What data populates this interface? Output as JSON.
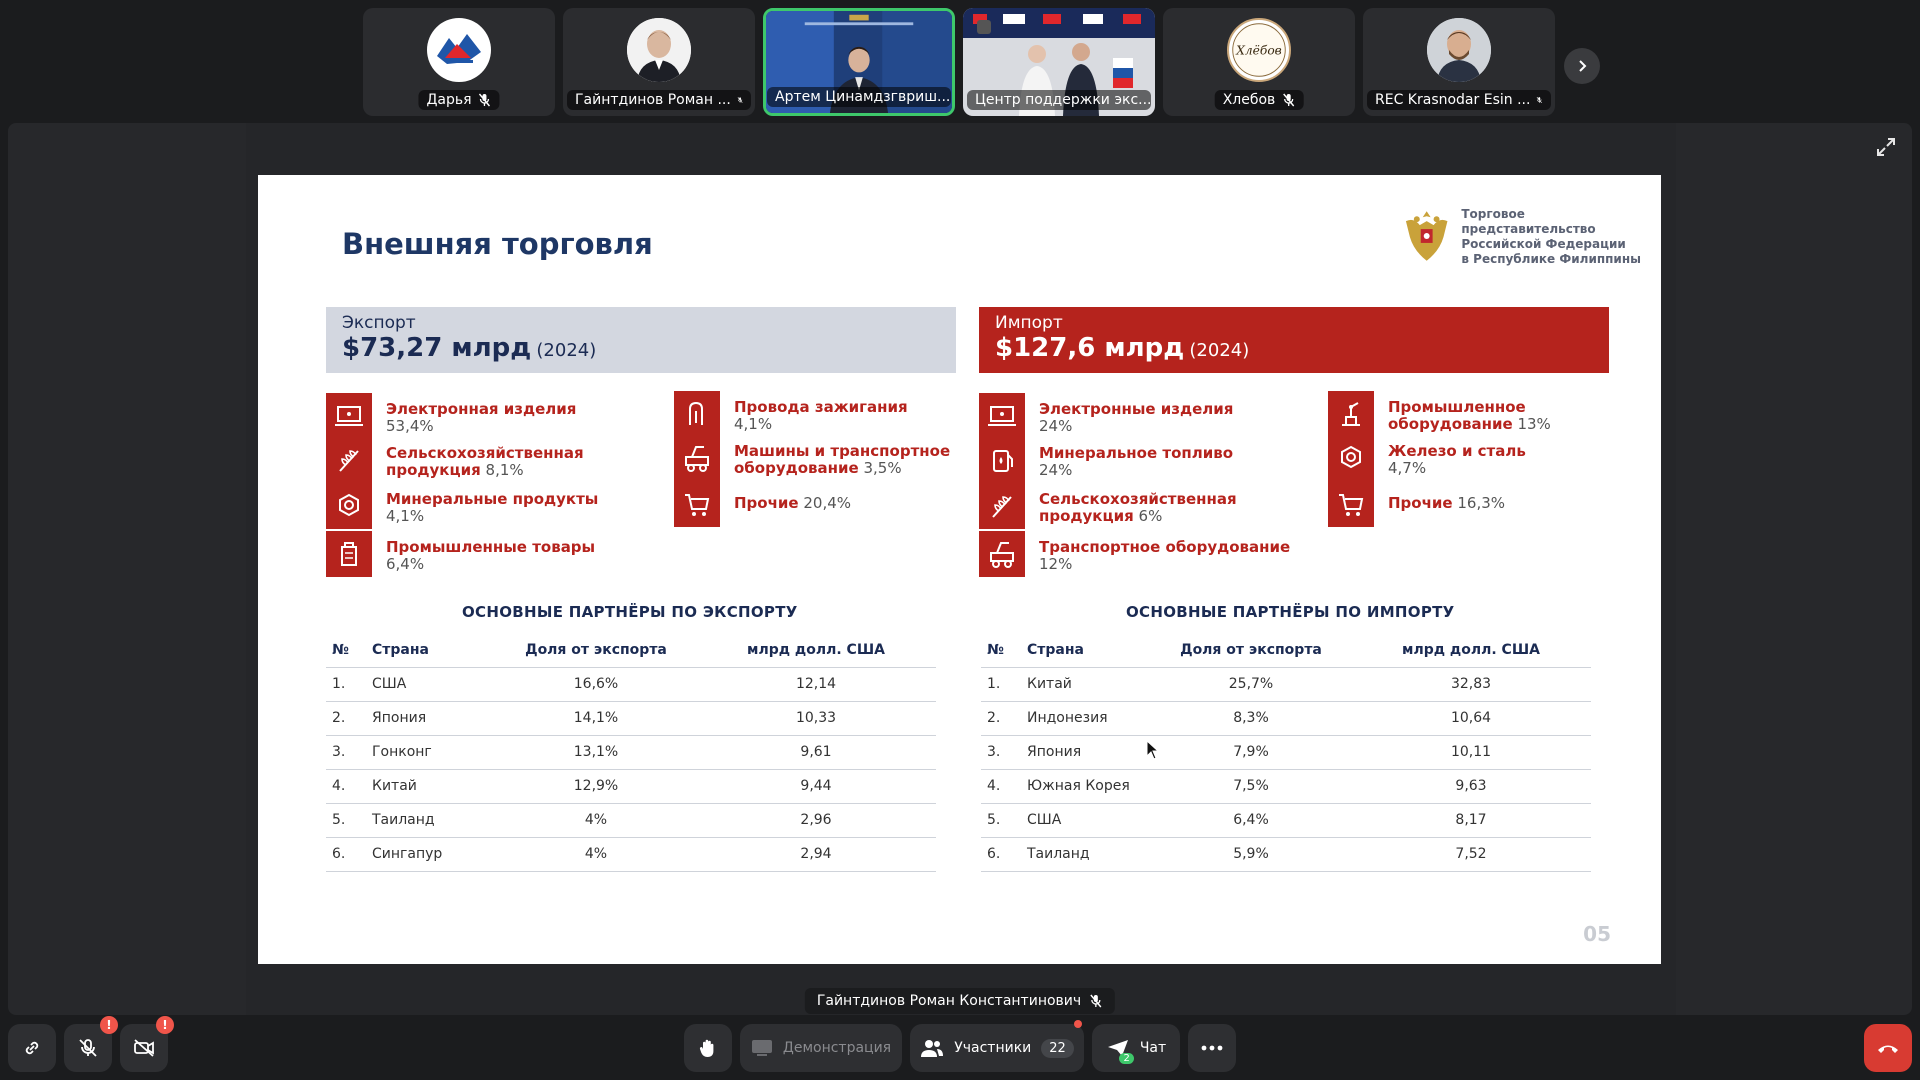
{
  "participants": [
    {
      "name": "Дарья",
      "muted": true
    },
    {
      "name": "Гайнтдинов Роман ...",
      "muted": true
    },
    {
      "name": "Артем Цинамдзгвриш...",
      "muted": false
    },
    {
      "name": "Центр поддержки экс...",
      "muted": false
    },
    {
      "name": "Хлебов",
      "muted": true
    },
    {
      "name": "REC Krasnodar Esin ...",
      "muted": true
    }
  ],
  "tile_overlay_text": {
    "hlebov_logo": "Хлёбов"
  },
  "slide": {
    "title": "Внешняя торговля",
    "rep_logo_lines": [
      "Торговое представительство",
      "Российской Федерации",
      "в Республике Филиппины"
    ],
    "page": "05",
    "export": {
      "label": "Экспорт",
      "amount": "$73,27 млрд",
      "year": "(2024)",
      "items_left": [
        {
          "name": "Электронная изделия",
          "share": "53,4%"
        },
        {
          "name": "Сельскохозяйственная продукция",
          "share": "8,1%"
        },
        {
          "name": "Минеральные продукты",
          "share": "4,1%"
        },
        {
          "name": "Промышленные товары",
          "share": "6,4%"
        }
      ],
      "items_right": [
        {
          "name": "Провода зажигания",
          "share": "4,1%"
        },
        {
          "name": "Машины и транспортное оборудование",
          "share": "3,5%"
        },
        {
          "name": "Прочие",
          "share": "20,4%"
        }
      ],
      "table_title": "ОСНОВНЫЕ ПАРТНЁРЫ ПО ЭКСПОРТУ",
      "columns": [
        "№",
        "Страна",
        "Доля от экспорта",
        "млрд долл. США"
      ],
      "rows": [
        [
          "1.",
          "США",
          "16,6%",
          "12,14"
        ],
        [
          "2.",
          "Япония",
          "14,1%",
          "10,33"
        ],
        [
          "3.",
          "Гонконг",
          "13,1%",
          "9,61"
        ],
        [
          "4.",
          "Китай",
          "12,9%",
          "9,44"
        ],
        [
          "5.",
          "Таиланд",
          "4%",
          "2,96"
        ],
        [
          "6.",
          "Сингапур",
          "4%",
          "2,94"
        ]
      ]
    },
    "import": {
      "label": "Импорт",
      "amount": "$127,6 млрд",
      "year": "(2024)",
      "items_left": [
        {
          "name": "Электронные изделия",
          "share": "24%"
        },
        {
          "name": "Минеральное топливо",
          "share": "24%"
        },
        {
          "name": "Сельскохозяйственная продукция",
          "share": "6%"
        },
        {
          "name": "Транспортное оборудование",
          "share": "12%"
        }
      ],
      "items_right": [
        {
          "name": "Промышленное оборудование",
          "share": "13%"
        },
        {
          "name": "Железо и сталь",
          "share": "4,7%"
        },
        {
          "name": "Прочие",
          "share": "16,3%"
        }
      ],
      "table_title": "ОСНОВНЫЕ ПАРТНЁРЫ ПО ИМПОРТУ",
      "columns": [
        "№",
        "Страна",
        "Доля от экспорта",
        "млрд долл. США"
      ],
      "rows": [
        [
          "1.",
          "Китай",
          "25,7%",
          "32,83"
        ],
        [
          "2.",
          "Индонезия",
          "8,3%",
          "10,64"
        ],
        [
          "3.",
          "Япония",
          "7,9%",
          "10,11"
        ],
        [
          "4.",
          "Южная Корея",
          "7,5%",
          "9,63"
        ],
        [
          "5.",
          "США",
          "6,4%",
          "8,17"
        ],
        [
          "6.",
          "Таиланд",
          "5,9%",
          "7,52"
        ]
      ]
    }
  },
  "speaker": {
    "name": "Гайнтдинов Роман Константинович"
  },
  "controls": {
    "alert_badge": "!",
    "demo_label": "Демонстрация",
    "participants_label": "Участники",
    "participants_count": "22",
    "chat_label": "Чат",
    "chat_count": "2"
  },
  "colors": {
    "accent_red": "#b5231d",
    "navy": "#1e3765",
    "active_tile": "#3ec86b",
    "alert": "#f0554a"
  }
}
